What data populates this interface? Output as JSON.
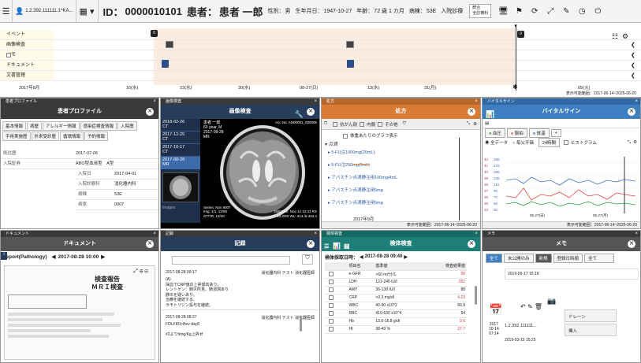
{
  "header": {
    "user_id": "1.2.392.111111.1^KA...",
    "id_label": "ID：",
    "id_value": "0000010101",
    "patient_label": "患者：",
    "patient_name": "患者 一郎",
    "sex_label": "性別：",
    "sex_value": "男",
    "dob_label": "生年月日：",
    "dob_value": "1947-10-27",
    "age_label": "年齢：",
    "age_value": "72 歳 1 カ月",
    "ward_label": "病棟：",
    "ward_value": "53E",
    "status_value": "入院診療",
    "dropdown_label": "統合\n全診療科"
  },
  "timeline": {
    "rows": [
      "イベント",
      "画像検査",
      "メモ",
      "ドキュメント",
      "文書管理"
    ],
    "scale_labels": [
      "2017年8月",
      "16(水)",
      "23(水)",
      "30(水)",
      "08-27(日)",
      "13(水)",
      "31(月)",
      "05(火)"
    ],
    "range_text": "表示可能範囲：2017-06-14~2025-06-20",
    "badge1": "0",
    "badge2": "0"
  },
  "profile": {
    "header": "患者プロファイル",
    "title": "患者プロファイル",
    "tabs": [
      "基本情報",
      "病歴",
      "アレルギー情報",
      "感染症検査情報",
      "入院歴",
      "手術実施歴",
      "外来受診歴",
      "循環情報",
      "予約情報"
    ],
    "kv": [
      {
        "k": "既往歴",
        "v": "2017-07-06"
      },
      {
        "k": "入院証券",
        "v": "ABO型血液型　A型"
      }
    ],
    "subrows": [
      {
        "k": "入院日",
        "v": "2017-04-01"
      },
      {
        "k": "入院診療科",
        "v": "消化器内科"
      },
      {
        "k": "病棟",
        "v": "53E"
      },
      {
        "k": "病室",
        "v": "0007"
      }
    ]
  },
  "imaging": {
    "header": "画像検査",
    "title": "画像検査",
    "studies": [
      {
        "date": "2018-02-26",
        "mod": "CT"
      },
      {
        "date": "2017-12-25",
        "mod": "CT"
      },
      {
        "date": "2017-10-17",
        "mod": "CT"
      },
      {
        "date": "2017-08-28",
        "mod": "MR"
      }
    ],
    "overlay_tl": "患者 一郎\n60 year, M\n2017-08-28\nMR",
    "overlay_tr": "Acc.No: AN00001_000005",
    "overlay_br": "Distance: Nov 12 12:41 RX\n12,000/ WL: 414 /6-453.4",
    "overlay_bl": "Series: Nov 8007\nImg. 1/1, 12/55\nST/TR, 12/40",
    "images_label": "Images"
  },
  "orders": {
    "header": "処方",
    "title": "処方",
    "toolbar": [
      "抗がん剤",
      "内服",
      "その他"
    ],
    "checkbox_label": "体重あたりのグラフ表示",
    "section": "点滴",
    "drugs": [
      "5-FU注1000mg(20mL)",
      "5-FU注250mg(5mL)",
      "アバスチン点滴静注用100mg/4mL",
      "アバスチン点滴静注用5mg",
      "アバスチン点滴静注用5mg"
    ],
    "month": "2017年9月",
    "range_text": "表示可能範囲：2017-06-14~2025-06-20"
  },
  "vitals": {
    "header": "バイタルサイン",
    "title": "バイタルサイン",
    "legend": [
      "血圧",
      "脈拍",
      "体温"
    ],
    "radio_all": "全データ",
    "radio_avg": "毎父平価",
    "period": "24時間",
    "histogram": "ヒストグラム",
    "y_labels": [
      "42",
      "41",
      "40",
      "39",
      "38",
      "37",
      "36",
      "35",
      "34"
    ],
    "y2_labels": [
      "190",
      "170",
      "150",
      "130",
      "110",
      "90",
      "70",
      "50",
      "30"
    ],
    "x_labels": [
      "06-27(日)",
      "06-27(月)"
    ],
    "range_text": "表示可能範囲：2017-06-14~2025-06-20",
    "series": [
      {
        "name": "血圧",
        "color": "#e0463c"
      },
      {
        "name": "脈拍",
        "color": "#3a6fc9"
      },
      {
        "name": "体温",
        "color": "#2a9a3a"
      }
    ]
  },
  "document": {
    "header": "ドキュメント",
    "title": "ドキュメント",
    "report": "report(Pathology)",
    "date": "2017-08-28 10:00",
    "doc_title": "検査報告\nＭＲＩ検査"
  },
  "records": {
    "header": "記録",
    "title": "記録",
    "entries": [
      {
        "date": "2017-08-28 09:17",
        "dept": "消化器内科",
        "author": "テスト 消化器医師",
        "body": "(A)\n採血でCRP値の上昇傾向あり。\nレントゲン：肺炎所見、肺浸潤あり\n肺炎を疑いあり。\n治療を継続する。\nラモトリジン投与を継続。"
      },
      {
        "date": "2017-08-28 08:37",
        "dept": "消化器内科",
        "author": "テスト 消化器医師",
        "body": "FOLFIRI+Bev day8\n\n#2より5mg/Kg上昇せ"
      }
    ]
  },
  "labs": {
    "header": "検体検査",
    "title": "検体検査",
    "date_label": "検体採取日時：",
    "date_value": "2017-08-28 09:40",
    "cols": [
      "項目名",
      "基準値",
      "検査結果値"
    ],
    "rows": [
      {
        "name": "e-GFR",
        "ref": ">60 ml/分/1.",
        "val": "58",
        "color": "#d04040"
      },
      {
        "name": "LDH",
        "ref": "121-245 IU/l",
        "val": "282",
        "color": "#d04040"
      },
      {
        "name": "AMY",
        "ref": "36-138 IU/l",
        "val": "88",
        "color": "#222"
      },
      {
        "name": "CRP",
        "ref": "<0.3 mg/dl",
        "val": "4.23",
        "color": "#d04040"
      },
      {
        "name": "WBC",
        "ref": "40-90 x10^2",
        "val": "66.9",
        "color": "#222"
      },
      {
        "name": "RBC",
        "ref": "410-530 x10^4",
        "val": "54",
        "color": "#222"
      },
      {
        "name": "Hb",
        "ref": "13.0-16.8 g/dl",
        "val": "9.6",
        "color": "#d04040"
      },
      {
        "name": "Ht",
        "ref": "38-49 %",
        "val": "27.7",
        "color": "#d04040"
      }
    ]
  },
  "memo": {
    "header": "メモ",
    "title": "メモ",
    "tabs": [
      "全て",
      "未公開のみ",
      "新規",
      "登録日時順",
      "全て"
    ],
    "items": [
      {
        "date": "2019-09-17 15:18",
        "text": ""
      },
      {
        "date": "2019-03-15 15:25",
        "text": ""
      }
    ],
    "calendar_text": "2017\n10-14\n07:14",
    "calendar_id": "1.2.392.111111...",
    "side_buttons": [
      "ドレーン",
      "挿入"
    ]
  }
}
